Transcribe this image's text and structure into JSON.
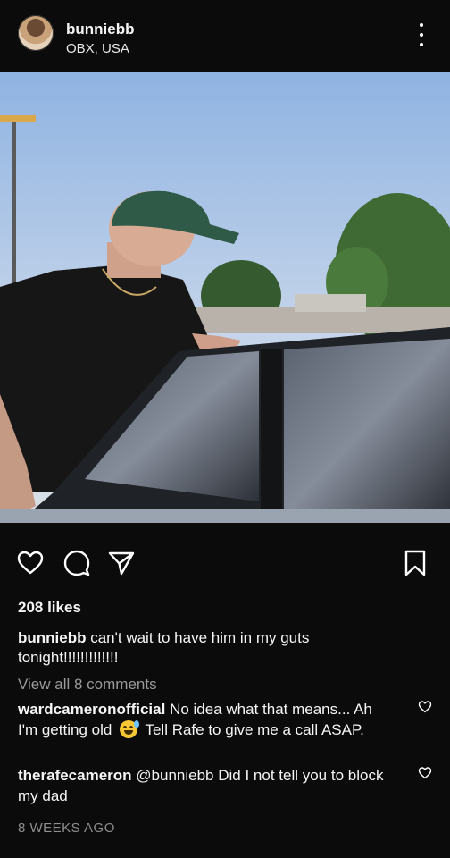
{
  "header": {
    "username": "bunniebb",
    "location": "OBX, USA",
    "avatar_icon": "profile-avatar",
    "more_icon": "more-vertical-icon"
  },
  "post": {
    "image_icon": "post-photo",
    "likes": "208 likes",
    "caption_username": "bunniebb",
    "caption_text": "can't wait to have him in my guts tonight!!!!!!!!!!!!!",
    "view_all": "View all 8 comments",
    "timestamp": "8 WEEKS AGO"
  },
  "actions": {
    "like_icon": "heart-icon",
    "comment_icon": "comment-icon",
    "share_icon": "paper-plane-icon",
    "save_icon": "bookmark-icon"
  },
  "comments": [
    {
      "username": "wardcameronofficial",
      "text_before_emoji": "No idea what that means... Ah I'm getting old",
      "emoji": "sweat-smile-emoji",
      "text_after_emoji": "Tell Rafe to give me a call ASAP."
    },
    {
      "username": "therafecameron",
      "text": "@bunniebb Did I not tell you to block my dad"
    }
  ],
  "colors": {
    "background": "#0b0b0b",
    "text": "#f5f5f5",
    "muted": "#9a9a9a"
  }
}
